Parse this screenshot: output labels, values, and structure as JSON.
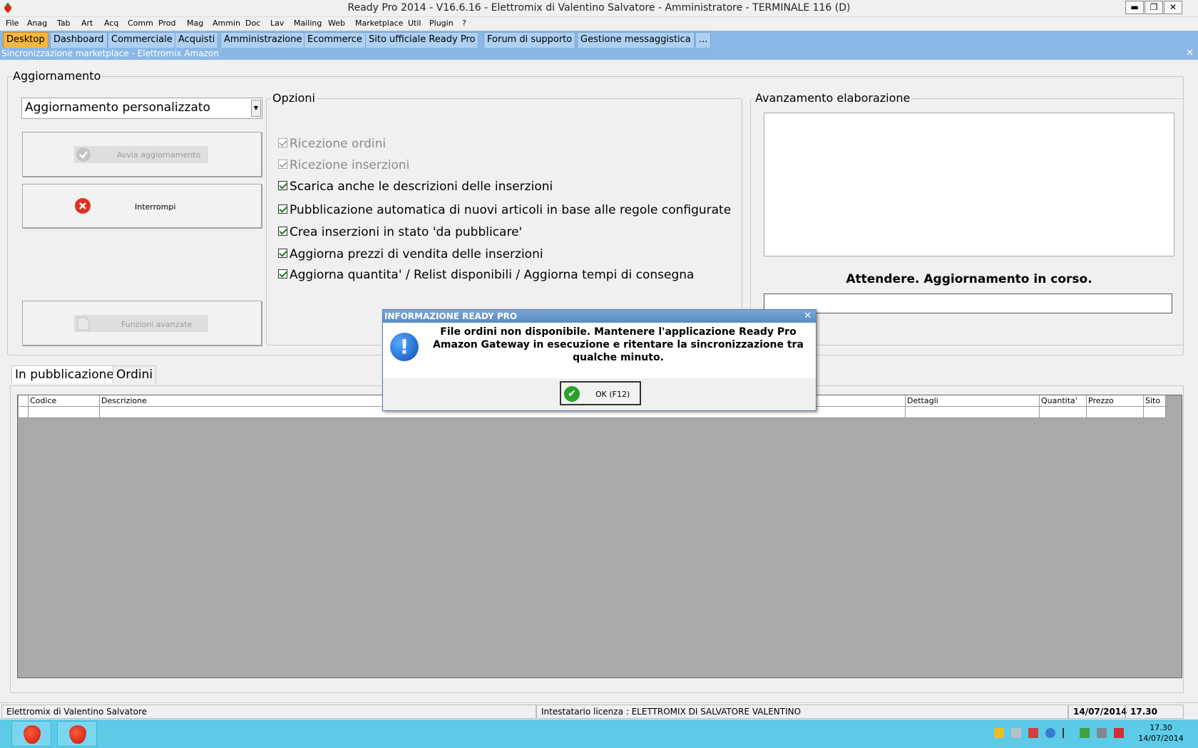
{
  "window": {
    "title": "Ready Pro 2014 - V16.6.16 - Elettromix di Valentino Salvatore - Amministratore - TERMINALE 116 (D)",
    "minimize": "▬",
    "restore": "❐",
    "close": "✕"
  },
  "menu": [
    "File",
    "Anag",
    "Tab",
    "Art",
    "Acq",
    "Comm",
    "Prod",
    "Mag",
    "Ammin",
    "Doc",
    "Lav",
    "Mailing",
    "Web",
    "Marketplace",
    "Util",
    "Plugin",
    "?"
  ],
  "tabs": [
    "Desktop",
    "Dashboard",
    "Commerciale",
    "Acquisti",
    "Amministrazione",
    "Ecommerce",
    "Sito ufficiale Ready Pro",
    "Forum di supporto",
    "Gestione messaggistica",
    "..."
  ],
  "subwindow": {
    "title": "Sincronizzazione marketplace - Elettromix Amazon",
    "close": "✕"
  },
  "aggiornamento": {
    "legend": "Aggiornamento",
    "mode_value": "Aggiornamento personalizzato",
    "mode_arrow": "▼",
    "start_button": "Avvia aggiornamento",
    "stop_button": "Interrompi",
    "advanced_button": "Funzioni avanzate"
  },
  "opzioni": {
    "legend": "Opzioni",
    "items": [
      {
        "label": "Ricezione ordini",
        "checked": true,
        "enabled": false
      },
      {
        "label": "Ricezione inserzioni",
        "checked": true,
        "enabled": false
      },
      {
        "label": "Scarica anche le descrizioni delle inserzioni",
        "checked": true,
        "enabled": true
      },
      {
        "label": "Pubblicazione automatica di nuovi articoli in base alle regole configurate",
        "checked": true,
        "enabled": true
      },
      {
        "label": "Crea inserzioni in stato 'da pubblicare'",
        "checked": true,
        "enabled": true
      },
      {
        "label": "Aggiorna prezzi di vendita delle inserzioni",
        "checked": true,
        "enabled": true
      },
      {
        "label": "Aggiorna quantita' / Relist disponibili / Aggiorna tempi di consegna",
        "checked": true,
        "enabled": true
      }
    ]
  },
  "avanzamento": {
    "legend": "Avanzamento elaborazione",
    "status": "Attendere. Aggiornamento in corso.",
    "progress": 0
  },
  "bottom_tabs": [
    "In pubblicazione",
    "Ordini"
  ],
  "grid": {
    "columns": [
      "Codice",
      "Descrizione",
      "Dettagli",
      "Quantita'",
      "Prezzo",
      "Sito"
    ]
  },
  "dialog": {
    "title": "INFORMAZIONE READY PRO",
    "close": "✕",
    "icon_symbol": "!",
    "message": "File ordini non disponibile. Mantenere l'applicazione Ready Pro Amazon Gateway in esecuzione e ritentare la sincronizzazione tra qualche minuto.",
    "ok_label": "OK (F12)",
    "ok_symbol": "✔"
  },
  "statusbar": {
    "company": "Elettromix di Valentino Salvatore",
    "license": "Intestatario licenza : ELETTROMIX DI SALVATORE VALENTINO",
    "date": "14/07/2014",
    "time": "17.30"
  },
  "taskbar": {
    "clock_time": "17.30",
    "clock_date": "14/07/2014"
  },
  "colors": {
    "accent": "#8ab8e6",
    "active_tab": "#f7b740",
    "taskbar": "#5ccbe8"
  }
}
